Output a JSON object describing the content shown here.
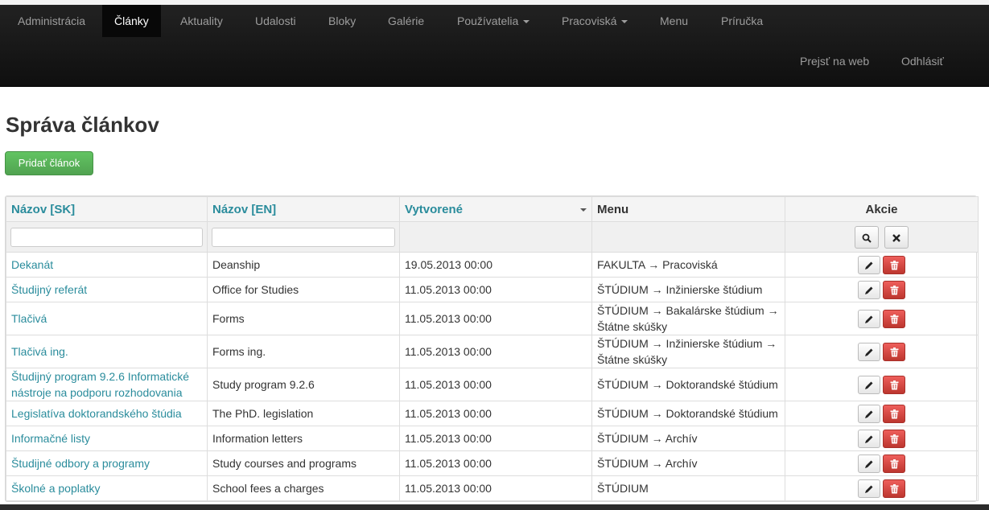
{
  "navbar": {
    "items": [
      {
        "label": "Administrácia"
      },
      {
        "label": "Články",
        "active": true
      },
      {
        "label": "Aktuality"
      },
      {
        "label": "Udalosti"
      },
      {
        "label": "Bloky"
      },
      {
        "label": "Galérie"
      },
      {
        "label": "Používatelia"
      },
      {
        "label": "Pracoviská"
      },
      {
        "label": "Menu"
      },
      {
        "label": "Príručka"
      }
    ],
    "right_items": [
      {
        "label": "Prejsť na web"
      },
      {
        "label": "Odhlásiť"
      }
    ]
  },
  "page": {
    "title": "Správa článkov",
    "add_button": "Pridať článok"
  },
  "table": {
    "columns": [
      "Názov [SK]",
      "Názov [EN]",
      "Vytvorené",
      "Menu",
      "Akcie"
    ],
    "filter_sk_value": "",
    "filter_en_value": "",
    "rows": [
      {
        "sk": "Dekanát",
        "en": "Deanship",
        "created": "19.05.2013 00:00",
        "menu": "FAKULTA → Pracoviská"
      },
      {
        "sk": "Študijný referát",
        "en": "Office for Studies",
        "created": "11.05.2013 00:00",
        "menu": "ŠTÚDIUM → Inžinierske štúdium"
      },
      {
        "sk": "Tlačivá",
        "en": "Forms",
        "created": "11.05.2013 00:00",
        "menu": "ŠTÚDIUM → Bakalárske štúdium → Štátne skúšky"
      },
      {
        "sk": "Tlačivá ing.",
        "en": "Forms ing.",
        "created": "11.05.2013 00:00",
        "menu": "ŠTÚDIUM → Inžinierske štúdium → Štátne skúšky"
      },
      {
        "sk": "Študijný program 9.2.6 Informatické nástroje na podporu rozhodovania",
        "en": "Study program 9.2.6",
        "created": "11.05.2013 00:00",
        "menu": "ŠTÚDIUM → Doktorandské štúdium"
      },
      {
        "sk": "Legislatíva doktorandského štúdia",
        "en": "The PhD. legislation",
        "created": "11.05.2013 00:00",
        "menu": "ŠTÚDIUM → Doktorandské štúdium"
      },
      {
        "sk": "Informačné listy",
        "en": "Information letters",
        "created": "11.05.2013 00:00",
        "menu": "ŠTÚDIUM → Archív"
      },
      {
        "sk": "Študijné odbory a programy",
        "en": "Study courses and programs",
        "created": "11.05.2013 00:00",
        "menu": "ŠTÚDIUM → Archív"
      },
      {
        "sk": "Školné a poplatky",
        "en": "School fees a charges",
        "created": "11.05.2013 00:00",
        "menu": "ŠTÚDIUM"
      }
    ]
  },
  "icons": {
    "edit": "pencil-icon",
    "delete": "trash-icon",
    "search": "search-icon",
    "clear": "close-icon"
  },
  "colors": {
    "link": "#2a8c9c",
    "add_button": "#5bb75b",
    "delete_button": "#da4f49",
    "navbar": "#1b1b1b"
  }
}
